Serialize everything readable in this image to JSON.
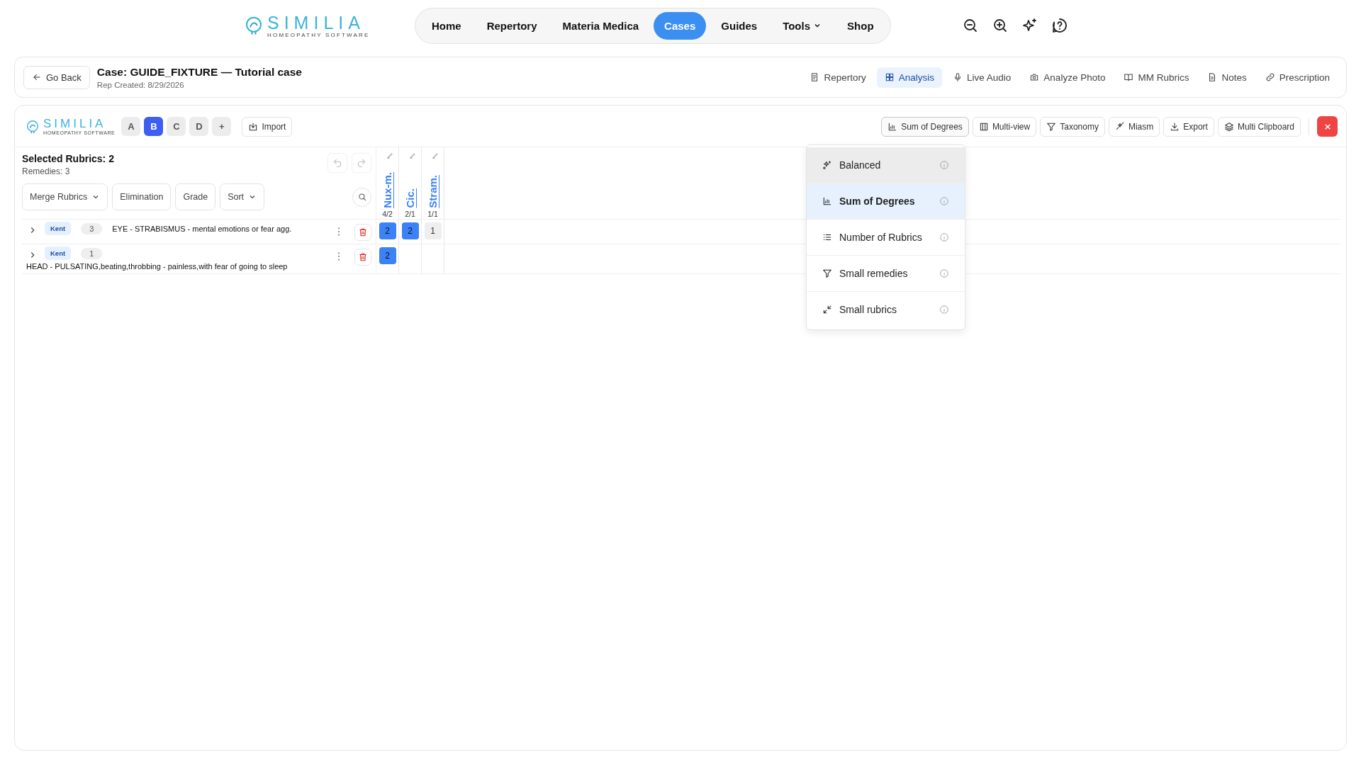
{
  "logo": {
    "name": "SIMILIA",
    "tagline": "HOMEOPATHY SOFTWARE"
  },
  "nav": [
    {
      "label": "Home",
      "selected": false,
      "kind": "link"
    },
    {
      "label": "Repertory",
      "selected": false,
      "kind": "link"
    },
    {
      "label": "Materia Medica",
      "selected": false,
      "kind": "link"
    },
    {
      "label": "Cases",
      "selected": true,
      "kind": "link"
    },
    {
      "label": "Guides",
      "selected": false,
      "kind": "link"
    },
    {
      "label": "Tools",
      "selected": false,
      "kind": "menu"
    },
    {
      "label": "Shop",
      "selected": false,
      "kind": "link"
    }
  ],
  "case": {
    "back": "Go Back",
    "title": "Case: GUIDE_FIXTURE — Tutorial case",
    "subtitle": "Rep Created: 8/29/2026",
    "tabs": [
      {
        "label": "Repertory",
        "selected": false
      },
      {
        "label": "Analysis",
        "selected": true
      },
      {
        "label": "Live Audio",
        "selected": false
      },
      {
        "label": "Analyze Photo",
        "selected": false
      },
      {
        "label": "MM Rubrics",
        "selected": false
      },
      {
        "label": "Notes",
        "selected": false
      },
      {
        "label": "Prescription",
        "selected": false
      }
    ]
  },
  "analysis": {
    "logo": {
      "name": "SIMILIA",
      "tagline": "HOMEOPATHY SOFTWARE"
    },
    "sheets": [
      {
        "label": "A",
        "selected": false
      },
      {
        "label": "B",
        "selected": true
      },
      {
        "label": "C",
        "selected": false
      },
      {
        "label": "D",
        "selected": false
      }
    ],
    "add": "+",
    "import": "Import",
    "tools": [
      {
        "label": "Sum of Degrees",
        "selected": true
      },
      {
        "label": "Multi-view",
        "selected": false
      },
      {
        "label": "Taxonomy",
        "selected": false
      },
      {
        "label": "Miasm",
        "selected": false
      },
      {
        "label": "Export",
        "selected": false
      },
      {
        "label": "Multi Clipboard",
        "selected": false
      }
    ],
    "strategies": [
      {
        "label": "Balanced",
        "selected": false,
        "hovered": true
      },
      {
        "label": "Sum of Degrees",
        "selected": true,
        "hovered": false
      },
      {
        "label": "Number of Rubrics",
        "selected": false,
        "hovered": false
      },
      {
        "label": "Small remedies",
        "selected": false,
        "hovered": false
      },
      {
        "label": "Small rubrics",
        "selected": false,
        "hovered": false
      }
    ],
    "summary": {
      "title": "Selected Rubrics: 2",
      "remedies": "Remedies: 3"
    },
    "filters": [
      {
        "label": "Merge Rubrics",
        "dropdown": true
      },
      {
        "label": "Elimination",
        "dropdown": false
      },
      {
        "label": "Grade",
        "dropdown": false
      },
      {
        "label": "Sort",
        "dropdown": true
      }
    ],
    "remedies": [
      {
        "name": "Nux-m.",
        "score": "4/2"
      },
      {
        "name": "Cic.",
        "score": "2/1"
      },
      {
        "name": "Stram.",
        "score": "1/1"
      }
    ],
    "rubrics": [
      {
        "book": "Kent",
        "count": "3",
        "text": "EYE - STRABISMUS - mental emotions or fear agg.",
        "cells": [
          {
            "value": "2",
            "color": "#3b82f6"
          },
          {
            "value": "2",
            "color": "#3b82f6"
          },
          {
            "value": "1",
            "color": "#eeeeee"
          }
        ]
      },
      {
        "book": "Kent",
        "count": "1",
        "text": "HEAD - PULSATING,beating,throbbing - painless,with fear of going to sleep",
        "cells": [
          {
            "value": "2",
            "color": "#3b82f6"
          },
          null,
          null
        ]
      }
    ]
  }
}
